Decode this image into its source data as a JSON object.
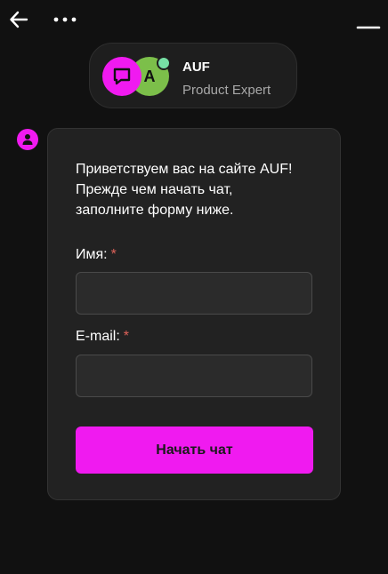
{
  "topbar": {
    "back_icon": "arrow-left-icon",
    "more_icon": "more-horizontal-icon",
    "minimize_icon": "minimize-icon"
  },
  "agent": {
    "brand_icon": "chat-bubble-icon",
    "initial": "A",
    "name": "AUF",
    "role": "Product Expert",
    "status_color": "#77e0a5"
  },
  "message": {
    "avatar_icon": "user-icon",
    "greeting_lines": [
      "Приветствуем вас на сайте AUF!",
      "Прежде чем начать чат,",
      "заполните форму ниже."
    ]
  },
  "form": {
    "name_label": "Имя:",
    "email_label": "E-mail:",
    "required_mark": "*",
    "name_value": "",
    "email_value": "",
    "submit_label": "Начать чат"
  },
  "colors": {
    "accent": "#f01af0",
    "background": "#111111",
    "card": "#222222",
    "required": "#e0625a"
  }
}
